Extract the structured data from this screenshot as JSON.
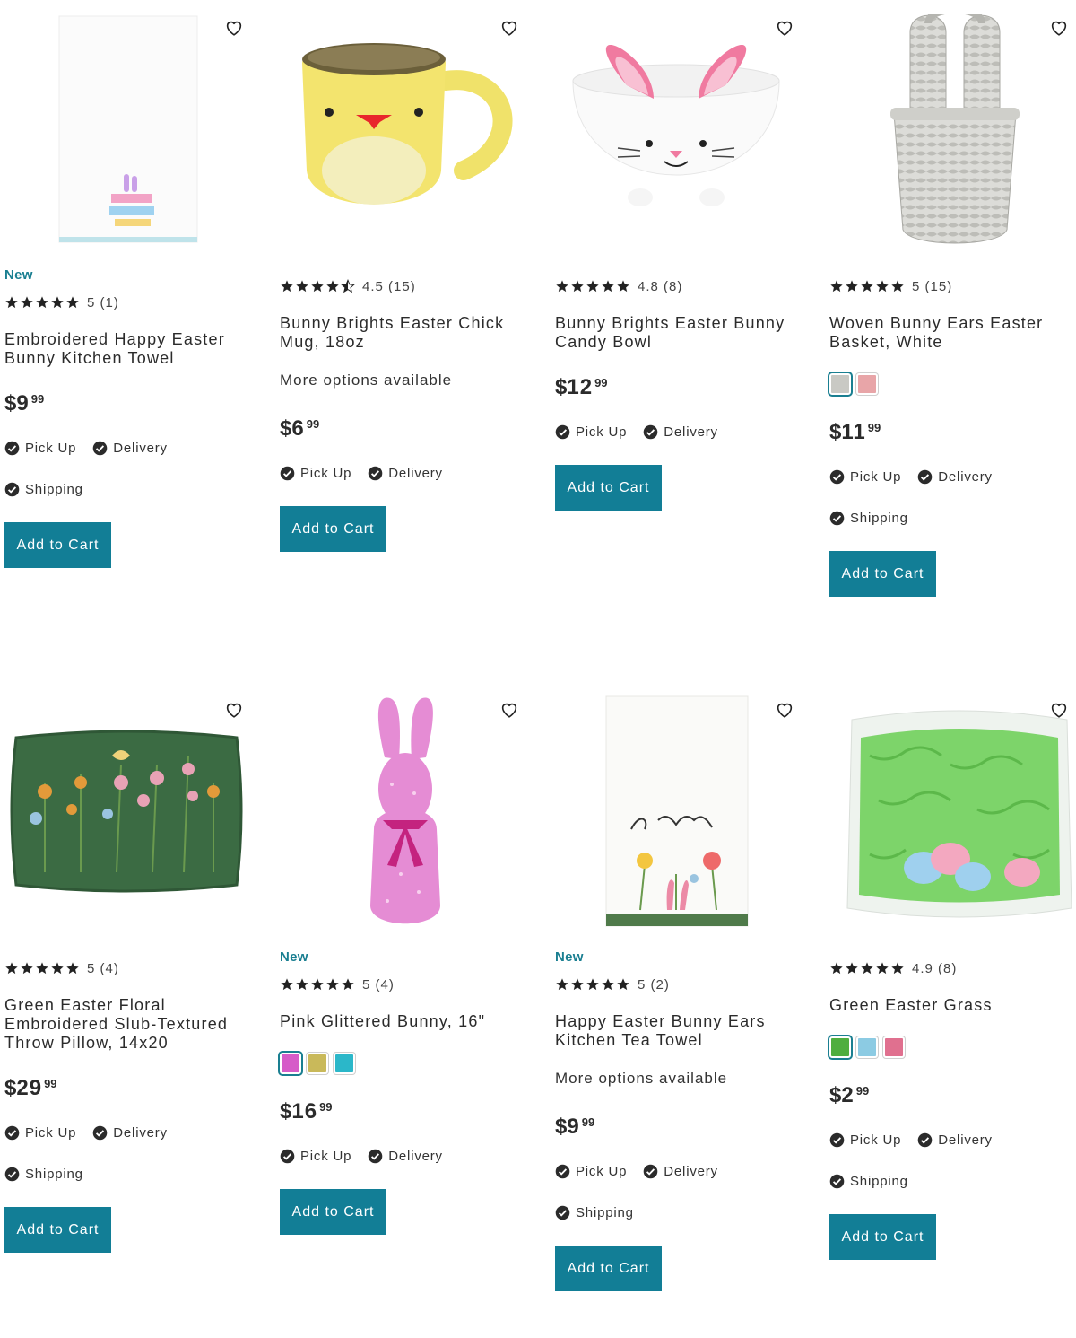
{
  "colors": {
    "accent": "#127e96",
    "new_badge": "#1a7f91",
    "text": "#2b2b2b"
  },
  "icons": {
    "wishlist": "heart-outline-icon",
    "check": "check-circle-icon",
    "star": "star-icon"
  },
  "products": [
    {
      "badge": "New",
      "rating": 5,
      "rating_text": "5 (1)",
      "name": "Embroidered Happy Easter Bunny Kitchen Towel",
      "more_options": "",
      "swatches": [],
      "price": {
        "symbol": "$",
        "dollars": "9",
        "cents": "99"
      },
      "fulfillment": [
        "Pick Up",
        "Delivery",
        "Shipping"
      ],
      "add_to_cart": "Add to Cart"
    },
    {
      "badge": "",
      "rating": 4.5,
      "rating_text": "4.5 (15)",
      "name": "Bunny Brights Easter Chick Mug, 18oz",
      "more_options": "More options available",
      "swatches": [],
      "price": {
        "symbol": "$",
        "dollars": "6",
        "cents": "99"
      },
      "fulfillment": [
        "Pick Up",
        "Delivery"
      ],
      "add_to_cart": "Add to Cart"
    },
    {
      "badge": "",
      "rating": 5,
      "rating_text": "4.8 (8)",
      "name": "Bunny Brights Easter Bunny Candy Bowl",
      "more_options": "",
      "swatches": [],
      "price": {
        "symbol": "$",
        "dollars": "12",
        "cents": "99"
      },
      "fulfillment": [
        "Pick Up",
        "Delivery"
      ],
      "add_to_cart": "Add to Cart"
    },
    {
      "badge": "",
      "rating": 5,
      "rating_text": "5 (15)",
      "name": "Woven Bunny Ears Easter Basket, White",
      "more_options": "",
      "swatches": [
        "#c9c9c4",
        "#e8a5a8"
      ],
      "price": {
        "symbol": "$",
        "dollars": "11",
        "cents": "99"
      },
      "fulfillment": [
        "Pick Up",
        "Delivery",
        "Shipping"
      ],
      "add_to_cart": "Add to Cart"
    },
    {
      "badge": "",
      "rating": 5,
      "rating_text": "5 (4)",
      "name": "Green Easter Floral Embroidered Slub-Textured Throw Pillow, 14x20",
      "more_options": "",
      "swatches": [],
      "price": {
        "symbol": "$",
        "dollars": "29",
        "cents": "99"
      },
      "fulfillment": [
        "Pick Up",
        "Delivery",
        "Shipping"
      ],
      "add_to_cart": "Add to Cart"
    },
    {
      "badge": "New",
      "rating": 5,
      "rating_text": "5 (4)",
      "name": "Pink Glittered Bunny, 16\"",
      "more_options": "",
      "swatches": [
        "#d65bc8",
        "#c9b95a",
        "#2bb7c9"
      ],
      "price": {
        "symbol": "$",
        "dollars": "16",
        "cents": "99"
      },
      "fulfillment": [
        "Pick Up",
        "Delivery"
      ],
      "add_to_cart": "Add to Cart"
    },
    {
      "badge": "New",
      "rating": 5,
      "rating_text": "5 (2)",
      "name": "Happy Easter Bunny Ears Kitchen Tea Towel",
      "more_options": "More options available",
      "swatches": [],
      "price": {
        "symbol": "$",
        "dollars": "9",
        "cents": "99"
      },
      "fulfillment": [
        "Pick Up",
        "Delivery",
        "Shipping"
      ],
      "add_to_cart": "Add to Cart"
    },
    {
      "badge": "",
      "rating": 5,
      "rating_text": "4.9 (8)",
      "name": "Green Easter Grass",
      "more_options": "",
      "swatches": [
        "#4fae3f",
        "#8ccbe3",
        "#e0708f"
      ],
      "price": {
        "symbol": "$",
        "dollars": "2",
        "cents": "99"
      },
      "fulfillment": [
        "Pick Up",
        "Delivery",
        "Shipping"
      ],
      "add_to_cart": "Add to Cart"
    }
  ]
}
